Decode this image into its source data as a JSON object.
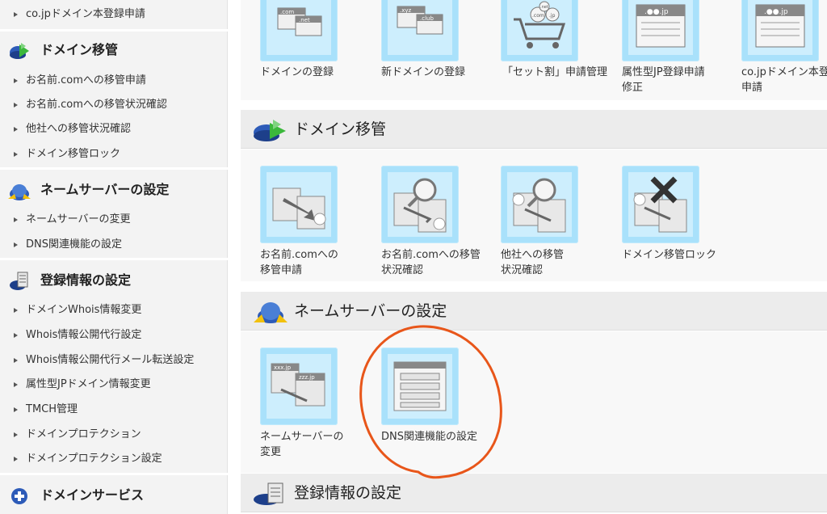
{
  "sidebar": {
    "top_items": [
      "co.jpドメイン本登録申請"
    ],
    "groups": [
      {
        "title": "ドメイン移管",
        "icon": "domain-transfer-icon",
        "items": [
          "お名前.comへの移管申請",
          "お名前.comへの移管状況確認",
          "他社への移管状況確認",
          "ドメイン移管ロック"
        ]
      },
      {
        "title": "ネームサーバーの設定",
        "icon": "name-server-icon",
        "items": [
          "ネームサーバーの変更",
          "DNS関連機能の設定"
        ]
      },
      {
        "title": "登録情報の設定",
        "icon": "registration-info-icon",
        "items": [
          "ドメインWhois情報変更",
          "Whois情報公開代行設定",
          "Whois情報公開代行メール転送設定",
          "属性型JPドメイン情報変更",
          "TMCH管理",
          "ドメインプロテクション",
          "ドメインプロテクション設定"
        ]
      },
      {
        "title": "ドメインサービス",
        "icon": "plus-circle-icon",
        "items": []
      }
    ]
  },
  "main": {
    "top_row": {
      "tiles": [
        {
          "label_lines": [
            "ドメインの登録"
          ],
          "icon": "domain-register-icon",
          "art": [
            ".com",
            ".net"
          ]
        },
        {
          "label_lines": [
            "新ドメインの登録"
          ],
          "icon": "new-domain-register-icon",
          "art": [
            ".xyz",
            ".club"
          ]
        },
        {
          "label_lines": [
            "「セット割」申請管理"
          ],
          "icon": "set-discount-cart-icon",
          "art": [
            ".com",
            ".jp",
            ".net"
          ]
        },
        {
          "label_lines": [
            "属性型JP登録申請",
            "修正"
          ],
          "icon": "attribute-jp-icon",
          "art": [
            ".●●.jp"
          ]
        },
        {
          "label_lines": [
            "co.jpドメイン本登",
            "申請"
          ],
          "icon": "co-jp-register-icon",
          "art": [
            ".●●.jp"
          ]
        }
      ]
    },
    "sections": [
      {
        "title": "ドメイン移管",
        "icon": "domain-transfer-icon",
        "tiles": [
          {
            "label_lines": [
              "お名前.comへの",
              "移管申請"
            ],
            "icon": "transfer-in-icon"
          },
          {
            "label_lines": [
              "お名前.comへの移管",
              "状況確認"
            ],
            "icon": "transfer-status-icon"
          },
          {
            "label_lines": [
              "他社への移管",
              "状況確認"
            ],
            "icon": "transfer-out-status-icon"
          },
          {
            "label_lines": [
              "ドメイン移管ロック"
            ],
            "icon": "transfer-lock-icon"
          }
        ]
      },
      {
        "title": "ネームサーバーの設定",
        "icon": "name-server-icon",
        "tiles": [
          {
            "label_lines": [
              "ネームサーバーの",
              "変更"
            ],
            "icon": "name-server-change-icon",
            "art": [
              "xxx.jp",
              "zzz.jp"
            ]
          },
          {
            "label_lines": [
              "DNS関連機能の設定"
            ],
            "icon": "dns-settings-icon"
          }
        ]
      },
      {
        "title": "登録情報の設定",
        "icon": "registration-info-icon",
        "tiles": []
      }
    ]
  },
  "colors": {
    "tile_bg": "#a9e1fb",
    "tile_inner": "#cdeefd",
    "annotation": "#e8561a",
    "sidebar_bg": "#f3f3f3",
    "section_header_bg": "#ececec"
  }
}
